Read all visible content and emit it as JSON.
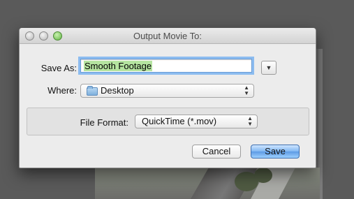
{
  "dialog": {
    "title": "Output Movie To:",
    "save_as_label": "Save As:",
    "save_as_value": "Smooth Footage",
    "where_label": "Where:",
    "where_value": "Desktop",
    "file_format_label": "File Format:",
    "file_format_value": "QuickTime (*.mov)",
    "cancel_label": "Cancel",
    "save_label": "Save",
    "expand_icon": "triangle-down",
    "popup_icon": "up-down-arrows"
  }
}
